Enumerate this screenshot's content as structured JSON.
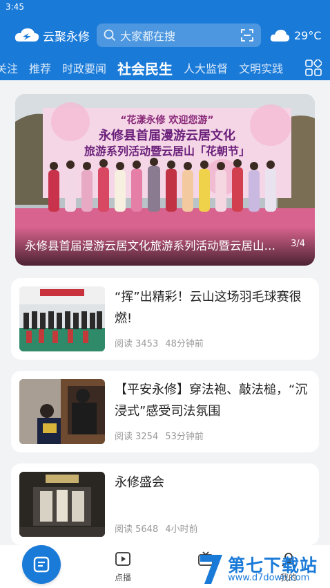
{
  "status_bar": {
    "time": "3:45"
  },
  "header": {
    "app_name": "云聚永修",
    "search_placeholder": "大家都在搜",
    "temperature": "29°C"
  },
  "tabs": [
    {
      "label": "关注"
    },
    {
      "label": "推荐"
    },
    {
      "label": "时政要闻"
    },
    {
      "label": "社会民生",
      "active": true
    },
    {
      "label": "人大监督"
    },
    {
      "label": "文明实践"
    }
  ],
  "banner": {
    "caption": "永修县首届漫游云居文化旅游系列活动暨云居山「花朝节」",
    "index": "3/4",
    "stage_text": {
      "line1": "“花漾永修 欢迎您游”",
      "line2": "永修县首届漫游云居文化",
      "line3": "旅游系列活动暨云居山「花朝节」"
    }
  },
  "news": [
    {
      "title": "“挥”出精彩！云山这场羽毛球赛很燃!",
      "reads": "阅读 3453",
      "time": "48分钟前"
    },
    {
      "title": "【平安永修】穿法袍、敲法槌，“沉浸式”感受司法氛围",
      "reads": "阅读 3254",
      "time": "53分钟前"
    },
    {
      "title": "永修盛会",
      "reads": "阅读 5648",
      "time": "4小时前"
    }
  ],
  "bottom_nav": [
    {
      "label": "点播"
    },
    {
      "label": "我的"
    }
  ],
  "watermark": {
    "text": "第七下载站",
    "url": "www.d7down.com"
  },
  "colors": {
    "primary": "#1a7ad8"
  }
}
